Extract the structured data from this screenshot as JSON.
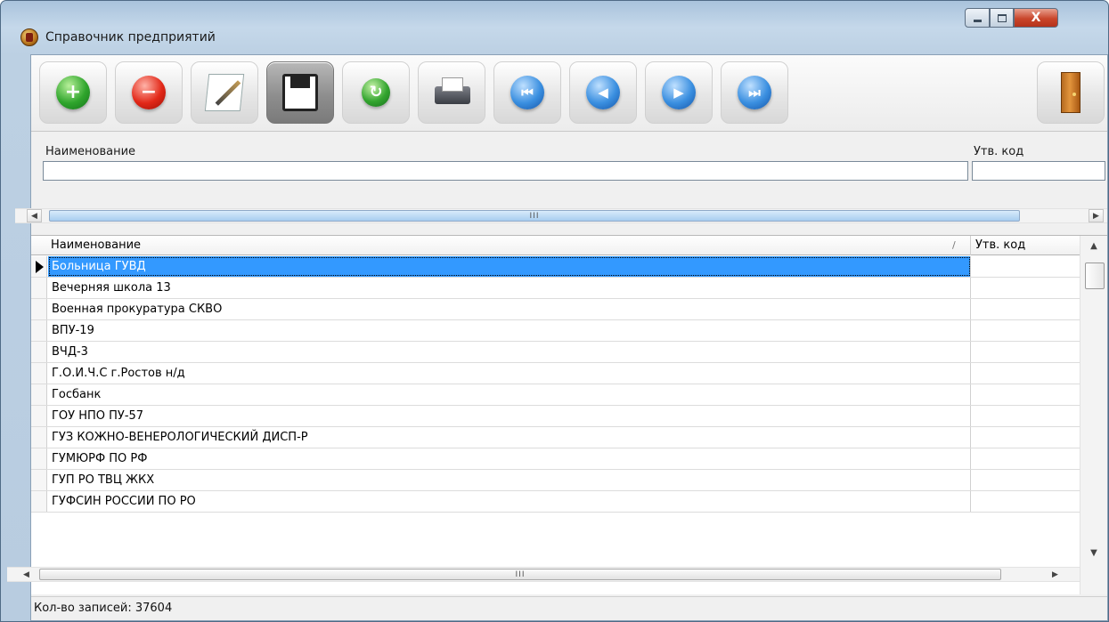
{
  "window": {
    "title": "Справочник предприятий",
    "close_glyph": "X"
  },
  "toolbar": {
    "buttons": [
      {
        "name": "add",
        "icon": "plus-icon",
        "glyph": "+"
      },
      {
        "name": "delete",
        "icon": "minus-icon",
        "glyph": "−"
      },
      {
        "name": "edit",
        "icon": "edit-icon"
      },
      {
        "name": "save",
        "icon": "floppy-icon",
        "pressed": true
      },
      {
        "name": "refresh",
        "icon": "refresh-icon",
        "glyph": "↻"
      },
      {
        "name": "print",
        "icon": "printer-icon"
      },
      {
        "name": "first",
        "icon": "first-record-icon",
        "glyph": "⏮"
      },
      {
        "name": "prev",
        "icon": "prev-record-icon",
        "glyph": "◀"
      },
      {
        "name": "next",
        "icon": "next-record-icon",
        "glyph": "▶"
      },
      {
        "name": "last",
        "icon": "last-record-icon",
        "glyph": "⏭"
      },
      {
        "name": "exit",
        "icon": "door-exit-icon"
      }
    ]
  },
  "filter": {
    "name_label": "Наименование",
    "name_value": "",
    "code_label": "Утв. код",
    "code_value": ""
  },
  "scroll": {
    "left_arrow": "◀",
    "right_arrow": "▶",
    "up_arrow": "▲",
    "down_arrow": "▼",
    "thumb_grip": "III"
  },
  "grid": {
    "columns": [
      "Наименование",
      "Утв. код"
    ],
    "sort_glyph": "/",
    "rows": [
      {
        "name": "Больница ГУВД",
        "code": ""
      },
      {
        "name": "Вечерняя школа 13",
        "code": ""
      },
      {
        "name": "Военная  прокуратура СКВО",
        "code": ""
      },
      {
        "name": "ВПУ-19",
        "code": ""
      },
      {
        "name": "ВЧД-3",
        "code": ""
      },
      {
        "name": "Г.О.И.Ч.С г.Ростов н/д",
        "code": ""
      },
      {
        "name": "Госбанк",
        "code": ""
      },
      {
        "name": "ГОУ   НПО ПУ-57",
        "code": ""
      },
      {
        "name": "ГУЗ КОЖНО-ВЕНЕРОЛОГИЧЕСКИЙ ДИСП-Р",
        "code": ""
      },
      {
        "name": "ГУМЮРФ  ПО РФ",
        "code": ""
      },
      {
        "name": "ГУП РО ТВЦ ЖКХ",
        "code": ""
      },
      {
        "name": "ГУФСИН РОССИИ ПО РО",
        "code": ""
      }
    ],
    "selected_index": 0
  },
  "status": {
    "records_text": "Кол-во записей: 37604"
  },
  "colors": {
    "selection": "#3399ff",
    "title_bar": "#c5d8ea",
    "close_button": "#c9462b"
  }
}
